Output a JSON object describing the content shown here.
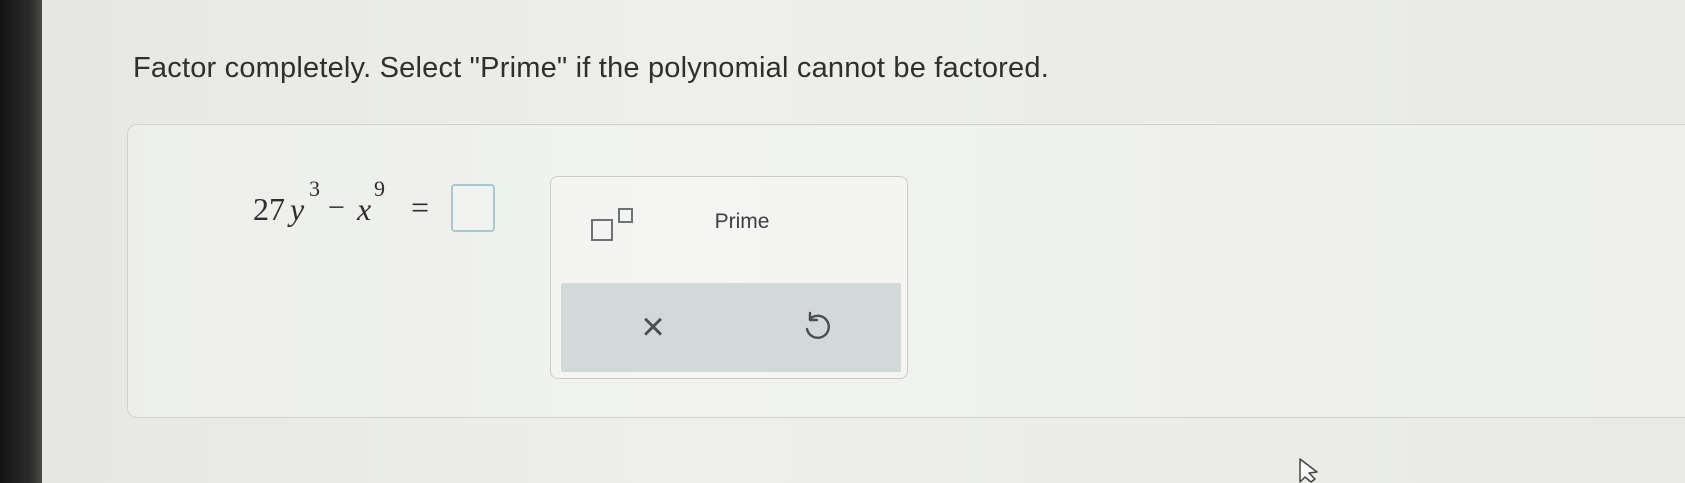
{
  "question": {
    "prompt": "Factor completely. Select \"Prime\" if the polynomial cannot be factored."
  },
  "equation": {
    "coefficient": "27",
    "variable_1": "y",
    "exponent_1": "3",
    "operator": "−",
    "variable_2": "x",
    "exponent_2": "9",
    "equals": "=",
    "answer_value": ""
  },
  "keypad": {
    "exponent_button_icon": "superscript-template-icon",
    "prime_label": "Prime",
    "clear_icon": "close-icon",
    "clear_glyph": "×",
    "undo_icon": "undo-icon"
  },
  "colors": {
    "accent": "#a9c7cf",
    "action_bar": "#d3d8d8",
    "text": "#2f2f30"
  }
}
